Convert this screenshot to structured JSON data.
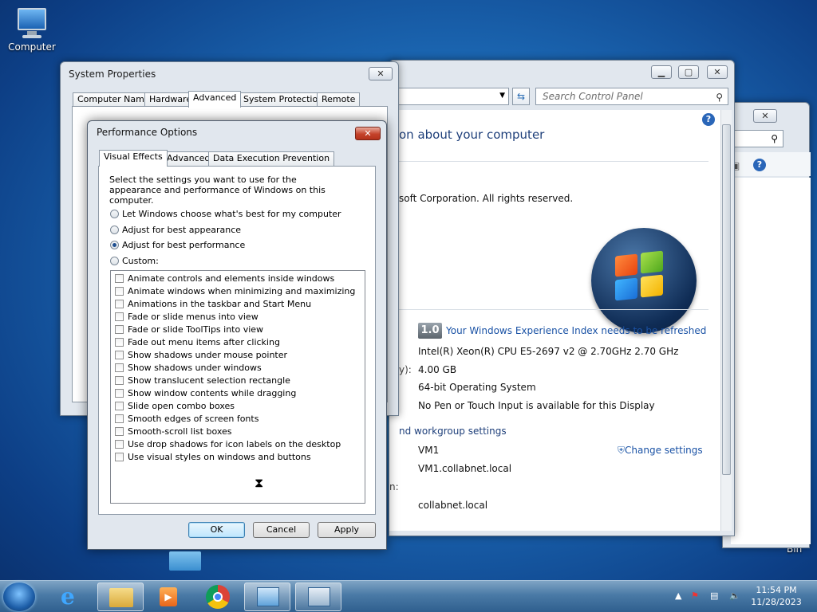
{
  "desktop": {
    "computer_label": "Computer",
    "recycle_bin_label": "Bin"
  },
  "control_panel": {
    "address_text": "",
    "search_placeholder": "Search Control Panel",
    "heading": "on about your computer",
    "copyright": "soft Corporation.  All rights reserved.",
    "wei_score": "1.0",
    "wei_link": "Your Windows Experience Index needs to be refreshed",
    "processor": "Intel(R) Xeon(R) CPU E5-2697 v2 @ 2.70GHz   2.70 GHz",
    "memory_label": "y):",
    "memory": "4.00 GB",
    "system_type": "64-bit Operating System",
    "pen_touch": "No Pen or Touch Input is available for this Display",
    "section_domain": "nd workgroup settings",
    "computer_name": "VM1",
    "full_name": "VM1.collabnet.local",
    "domain_label": "n:",
    "domain": "collabnet.local",
    "change_settings": "Change settings"
  },
  "system_properties": {
    "title": "System Properties",
    "tabs": [
      "Computer Name",
      "Hardware",
      "Advanced",
      "System Protection",
      "Remote"
    ],
    "selected_tab": "Advanced"
  },
  "performance_options": {
    "title": "Performance Options",
    "tabs": [
      "Visual Effects",
      "Advanced",
      "Data Execution Prevention"
    ],
    "selected_tab": "Visual Effects",
    "description": "Select the settings you want to use for the appearance and performance of Windows on this computer.",
    "radios": [
      {
        "label": "Let Windows choose what's best for my computer",
        "checked": false
      },
      {
        "label": "Adjust for best appearance",
        "checked": false
      },
      {
        "label": "Adjust for best performance",
        "checked": true
      },
      {
        "label": "Custom:",
        "checked": false
      }
    ],
    "effects": [
      "Animate controls and elements inside windows",
      "Animate windows when minimizing and maximizing",
      "Animations in the taskbar and Start Menu",
      "Fade or slide menus into view",
      "Fade or slide ToolTips into view",
      "Fade out menu items after clicking",
      "Show shadows under mouse pointer",
      "Show shadows under windows",
      "Show translucent selection rectangle",
      "Show window contents while dragging",
      "Slide open combo boxes",
      "Smooth edges of screen fonts",
      "Smooth-scroll list boxes",
      "Use drop shadows for icon labels on the desktop",
      "Use visual styles on windows and buttons"
    ],
    "buttons": {
      "ok": "OK",
      "cancel": "Cancel",
      "apply": "Apply"
    }
  },
  "taskbar": {
    "time": "11:54 PM",
    "date": "11/28/2023"
  },
  "colors": {
    "link": "#1a52a5",
    "close_red": "#c5432b"
  }
}
